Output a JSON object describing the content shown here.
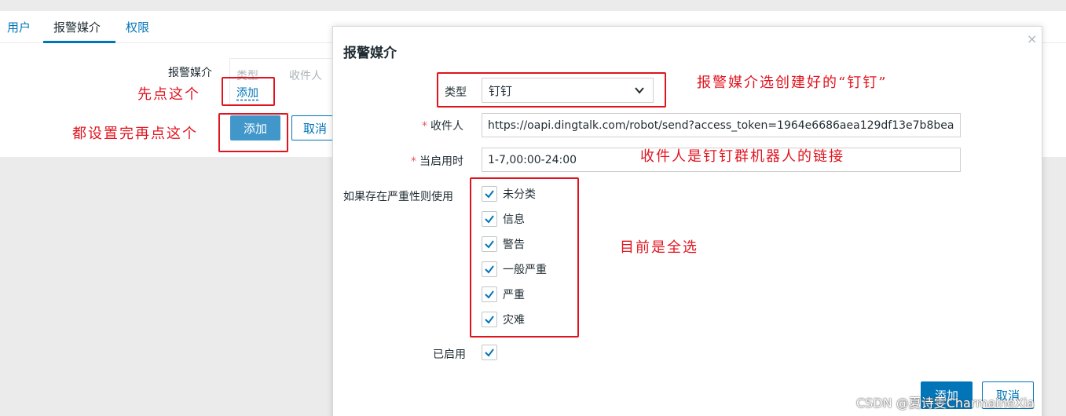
{
  "tabs": [
    "用户",
    "报警媒介",
    "权限"
  ],
  "background_form": {
    "label": "报警媒介",
    "col_type": "类型",
    "col_recipient": "收件人",
    "add_link": "添加",
    "add_button": "添加",
    "cancel_button": "取消"
  },
  "dialog": {
    "title": "报警媒介",
    "close": "×",
    "type_label": "类型",
    "type_value": "钉钉",
    "recipient_label": "收件人",
    "recipient_value": "https://oapi.dingtalk.com/robot/send?access_token=1964e6686aea129df13e7b8bea",
    "when_active_label": "当启用时",
    "when_active_value": "1-7,00:00-24:00",
    "severity_label": "如果存在严重性则使用",
    "severities": [
      {
        "label": "未分类",
        "checked": true
      },
      {
        "label": "信息",
        "checked": true
      },
      {
        "label": "警告",
        "checked": true
      },
      {
        "label": "一般严重",
        "checked": true
      },
      {
        "label": "严重",
        "checked": true
      },
      {
        "label": "灾难",
        "checked": true
      }
    ],
    "enabled_label": "已启用",
    "enabled_checked": true,
    "add_button": "添加",
    "cancel_button": "取消"
  },
  "annotations": {
    "click_first": "先点这个",
    "click_after": "都设置完再点这个",
    "select_dingtalk": "报警媒介选创建好的“钉钉”",
    "recipient_note": "收件人是钉钉群机器人的链接",
    "all_selected": "目前是全选"
  },
  "watermark": "CSDN @夏诗雯CharmaineXia",
  "colors": {
    "primary": "#0275b8",
    "annotation_red": "#e0141f",
    "required_star": "#e45959"
  }
}
